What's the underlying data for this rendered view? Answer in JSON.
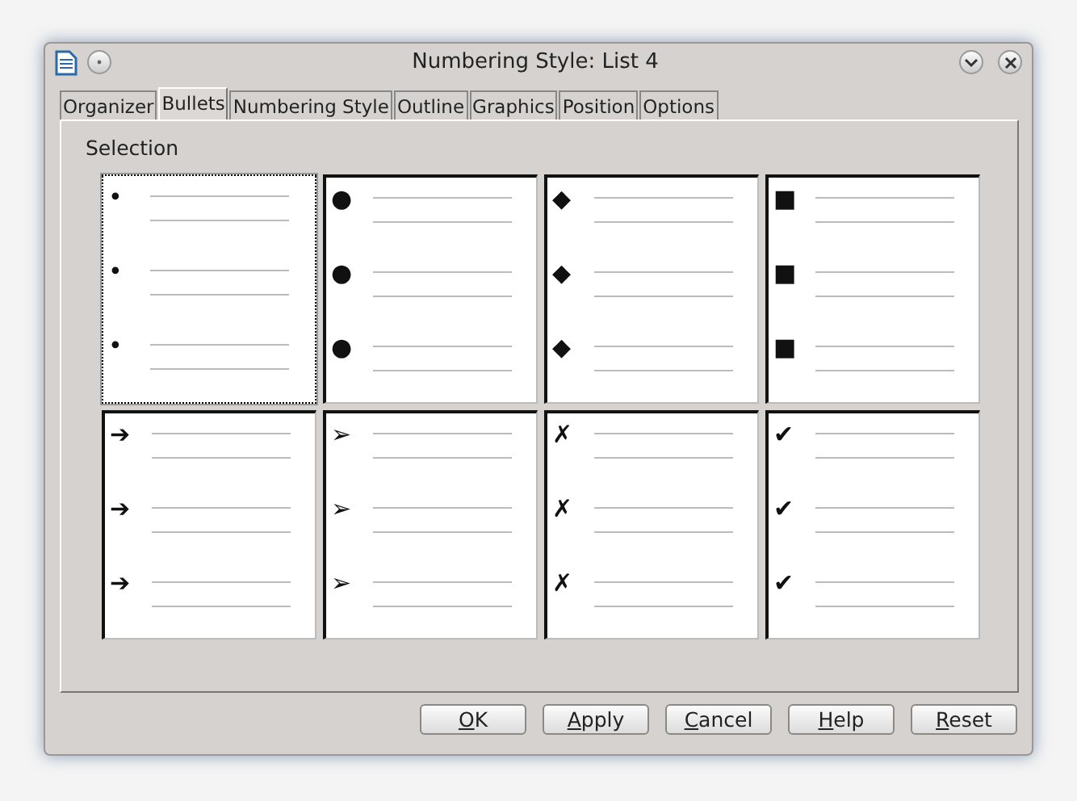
{
  "window": {
    "title": "Numbering Style: List 4"
  },
  "tabs": [
    {
      "label": "Organizer",
      "selected": false
    },
    {
      "label": "Bullets",
      "selected": true
    },
    {
      "label": "Numbering Style",
      "selected": false
    },
    {
      "label": "Outline",
      "selected": false
    },
    {
      "label": "Graphics",
      "selected": false
    },
    {
      "label": "Position",
      "selected": false
    },
    {
      "label": "Options",
      "selected": false
    }
  ],
  "selection": {
    "label": "Selection",
    "styles": [
      {
        "bullets": [
          "•",
          "•",
          "•"
        ],
        "selected": true
      },
      {
        "bullets": [
          "●",
          "●",
          "●"
        ],
        "selected": false
      },
      {
        "bullets": [
          "◆",
          "◆",
          "◆"
        ],
        "selected": false
      },
      {
        "bullets": [
          "■",
          "■",
          "■"
        ],
        "selected": false
      },
      {
        "bullets": [
          "➔",
          "➔",
          "➔"
        ],
        "selected": false
      },
      {
        "bullets": [
          "➢",
          "➢",
          "➢"
        ],
        "selected": false
      },
      {
        "bullets": [
          "✗",
          "✗",
          "✗"
        ],
        "selected": false
      },
      {
        "bullets": [
          "✔",
          "✔",
          "✔"
        ],
        "selected": false
      }
    ]
  },
  "buttons": [
    {
      "accel": "O",
      "rest": "K"
    },
    {
      "accel": "A",
      "rest": "pply"
    },
    {
      "accel": "C",
      "rest": "ancel"
    },
    {
      "accel": "H",
      "rest": "elp"
    },
    {
      "accel": "R",
      "rest": "eset"
    }
  ]
}
